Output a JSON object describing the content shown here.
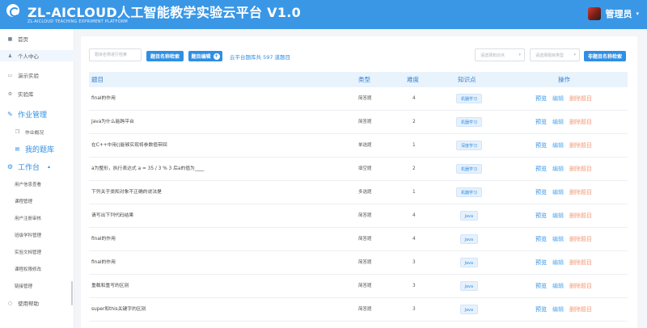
{
  "header": {
    "title": "ZL-AICLOUD人工智能教学实验云平台 V1.0",
    "subtitle": "ZL-AICLOUD TEACHING EXPRIMENT PLATFORM",
    "user_name": "管理员",
    "user_caret": "▾"
  },
  "sidebar": {
    "items": [
      {
        "label": "首页",
        "icon": "home-icon",
        "glyph": "■"
      },
      {
        "label": "个人中心",
        "icon": "user-icon",
        "glyph": "♟"
      },
      {
        "label": "演示实验",
        "icon": "monitor-icon",
        "glyph": "▭"
      },
      {
        "label": "实验库",
        "icon": "gear-icon",
        "glyph": "⚙"
      }
    ],
    "homework_group": {
      "label": "作业管理",
      "icon": "edit-icon",
      "glyph": "✎"
    },
    "homework_children": [
      {
        "label": "作业概况",
        "icon": "copy-icon",
        "glyph": "❐"
      },
      {
        "label": "我的题库",
        "icon": "list-icon",
        "glyph": "▤"
      }
    ],
    "workbench_group": {
      "label": "工作台",
      "icon": "settings-icon",
      "glyph": "⚙",
      "caret": "▴"
    },
    "workbench_children": [
      "用户信息查看",
      "课程管理",
      "用户注册审核",
      "班级学科管理",
      "实验文档管理",
      "课程权限修改",
      "链接管理"
    ],
    "help": {
      "label": "使用帮助",
      "icon": "help-icon",
      "glyph": "○"
    }
  },
  "toolbar": {
    "search_placeholder": "题目名称进行检索",
    "search_button": "题目名称检索",
    "filter_button": "题目编辑",
    "filter_icon": "+",
    "count_text": "云平台题库共 597 道题目",
    "kp_select_placeholder": "请选择知识点",
    "type_select_placeholder": "请选择题目类型",
    "select_caret": "▾",
    "nontitle_button": "非题目名称检索"
  },
  "table": {
    "columns": {
      "title": "题目",
      "type": "类型",
      "difficulty": "难度",
      "knowledge": "知识点",
      "actions": "操作"
    },
    "action_labels": {
      "preview": "预览",
      "edit": "编辑",
      "delete": "删除题目"
    },
    "rows": [
      {
        "title": "final的作用",
        "type": "简答题",
        "difficulty": "4",
        "knowledge": "机器学习"
      },
      {
        "title": "Java为什么能跨平台",
        "type": "简答题",
        "difficulty": "2",
        "knowledge": "机器学习"
      },
      {
        "title": "在C++中用()能够实现将参数值带回",
        "type": "单选题",
        "difficulty": "1",
        "knowledge": "深度学习"
      },
      {
        "title": "a为整形，执行表达式 a = 35 / 3 % 3 后a的值为____",
        "type": "填空题",
        "difficulty": "2",
        "knowledge": "机器学习"
      },
      {
        "title": "下列关于类和对象不正确的说法是",
        "type": "多选题",
        "difficulty": "1",
        "knowledge": "机器学习"
      },
      {
        "title": "请写出下列代码结果",
        "type": "简答题",
        "difficulty": "4",
        "knowledge": "Java"
      },
      {
        "title": "final的作用",
        "type": "简答题",
        "difficulty": "4",
        "knowledge": "Java"
      },
      {
        "title": "final的作用",
        "type": "简答题",
        "difficulty": "3",
        "knowledge": "Java"
      },
      {
        "title": "重载和重写的区别",
        "type": "简答题",
        "difficulty": "3",
        "knowledge": "Java"
      },
      {
        "title": "super和this关键字的区别",
        "type": "简答题",
        "difficulty": "3",
        "knowledge": "Java"
      }
    ]
  }
}
